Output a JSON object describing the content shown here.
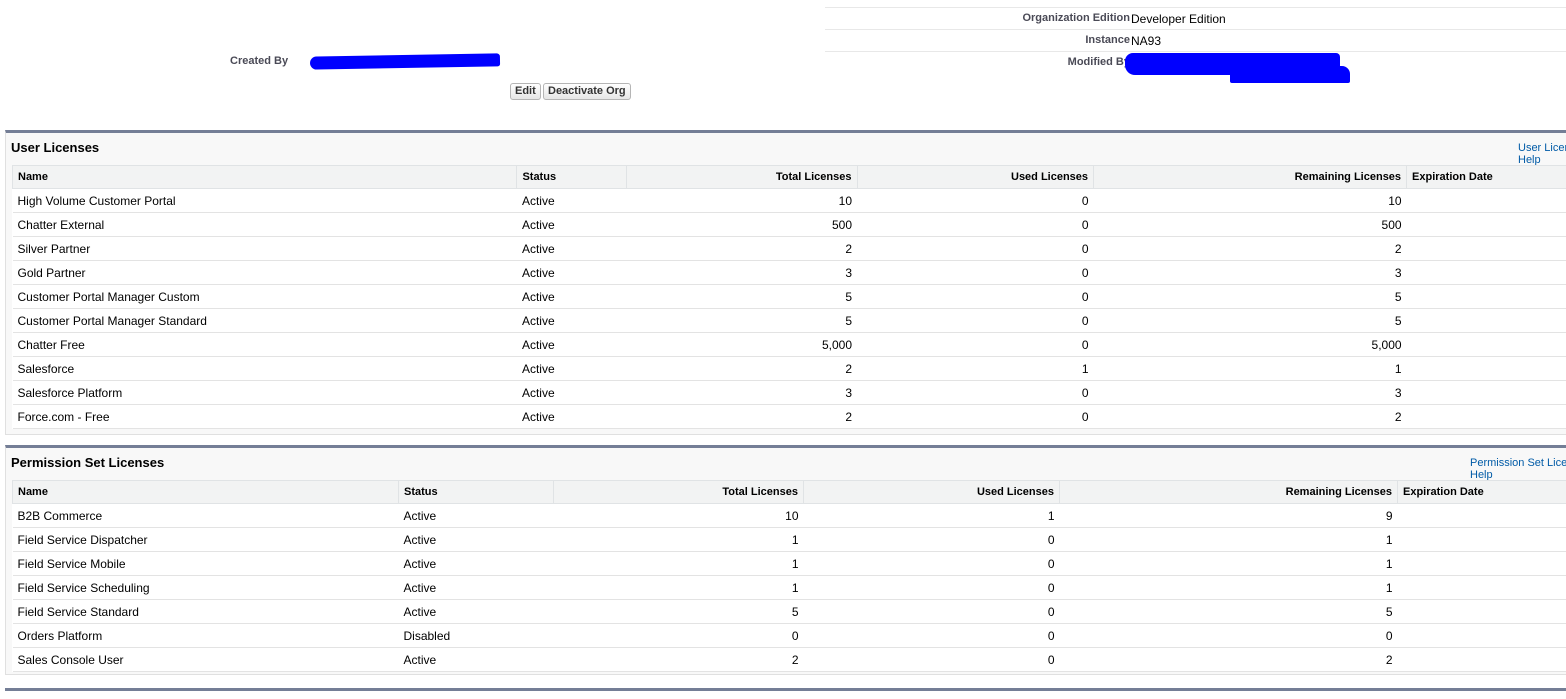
{
  "org_detail": {
    "rows": [
      {
        "label": "Organization Edition",
        "value": "Developer Edition"
      },
      {
        "label": "Instance",
        "value": "NA93"
      },
      {
        "label": "Modified By",
        "value": ""
      }
    ],
    "created_by_label": "Created By"
  },
  "buttons": {
    "edit": "Edit",
    "deactivate": "Deactivate Org"
  },
  "user_licenses": {
    "title": "User Licenses",
    "help_link": "User Licenses Help",
    "columns": [
      "Name",
      "Status",
      "Total Licenses",
      "Used Licenses",
      "Remaining Licenses",
      "Expiration Date"
    ],
    "rows": [
      [
        "High Volume Customer Portal",
        "Active",
        "10",
        "0",
        "10",
        ""
      ],
      [
        "Chatter External",
        "Active",
        "500",
        "0",
        "500",
        ""
      ],
      [
        "Silver Partner",
        "Active",
        "2",
        "0",
        "2",
        ""
      ],
      [
        "Gold Partner",
        "Active",
        "3",
        "0",
        "3",
        ""
      ],
      [
        "Customer Portal Manager Custom",
        "Active",
        "5",
        "0",
        "5",
        ""
      ],
      [
        "Customer Portal Manager Standard",
        "Active",
        "5",
        "0",
        "5",
        ""
      ],
      [
        "Chatter Free",
        "Active",
        "5,000",
        "0",
        "5,000",
        ""
      ],
      [
        "Salesforce",
        "Active",
        "2",
        "1",
        "1",
        ""
      ],
      [
        "Salesforce Platform",
        "Active",
        "3",
        "0",
        "3",
        ""
      ],
      [
        "Force.com - Free",
        "Active",
        "2",
        "0",
        "2",
        ""
      ]
    ]
  },
  "permission_set_licenses": {
    "title": "Permission Set Licenses",
    "help_link": "Permission Set Licenses Help",
    "columns": [
      "Name",
      "Status",
      "Total Licenses",
      "Used Licenses",
      "Remaining Licenses",
      "Expiration Date"
    ],
    "rows": [
      [
        "B2B Commerce",
        "Active",
        "10",
        "1",
        "9",
        ""
      ],
      [
        "Field Service Dispatcher",
        "Active",
        "1",
        "0",
        "1",
        ""
      ],
      [
        "Field Service Mobile",
        "Active",
        "1",
        "0",
        "1",
        ""
      ],
      [
        "Field Service Scheduling",
        "Active",
        "1",
        "0",
        "1",
        ""
      ],
      [
        "Field Service Standard",
        "Active",
        "5",
        "0",
        "5",
        ""
      ],
      [
        "Orders Platform",
        "Disabled",
        "0",
        "0",
        "0",
        ""
      ],
      [
        "Sales Console User",
        "Active",
        "2",
        "0",
        "2",
        ""
      ]
    ]
  }
}
